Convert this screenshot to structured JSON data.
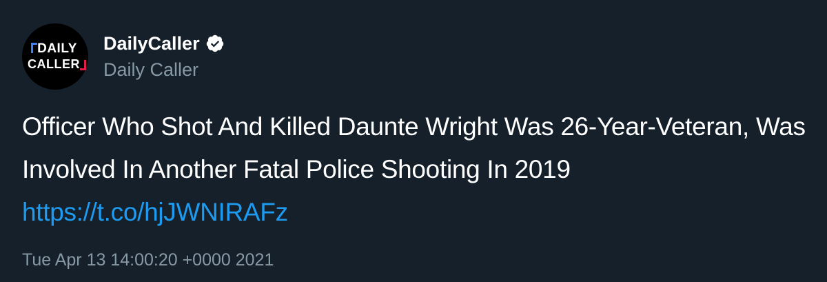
{
  "tweet": {
    "avatar": {
      "line1": "DAILY",
      "line2": "CALLER"
    },
    "display_name": "DailyCaller",
    "verified_icon": "verified-badge-icon",
    "handle": "Daily Caller",
    "text": "Officer Who Shot And Killed Daunte Wright Was 26-Year-Veteran, Was Involved In Another Fatal Police Shooting In 2019",
    "link": "https://t.co/hjJWNIRAFz",
    "timestamp": "Tue Apr 13 14:00:20 +0000 2021"
  },
  "colors": {
    "background": "#15202b",
    "text": "#ffffff",
    "secondary": "#8899a6",
    "link": "#1d9bf0",
    "logo_blue": "#3b82f6",
    "logo_red": "#e11d48"
  }
}
